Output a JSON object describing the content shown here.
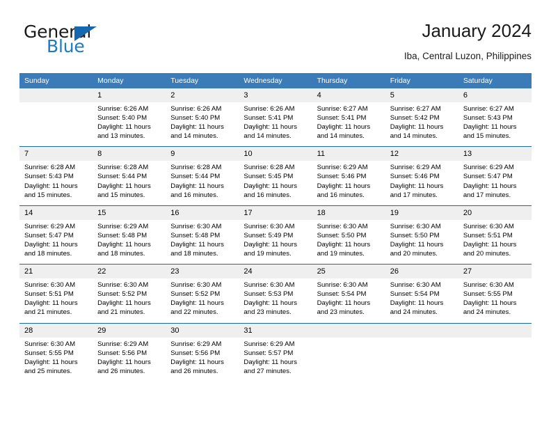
{
  "brand": {
    "name_part1": "General",
    "name_part2": "Blue",
    "accent_color": "#1d7bc1",
    "triangle_color": "#1667b0"
  },
  "header": {
    "title": "January 2024",
    "subtitle": "Iba, Central Luzon, Philippines"
  },
  "calendar": {
    "header_bg": "#3b7cb8",
    "daynum_bg": "#efefef",
    "weekday_headers": [
      "Sunday",
      "Monday",
      "Tuesday",
      "Wednesday",
      "Thursday",
      "Friday",
      "Saturday"
    ],
    "weeks": [
      [
        {
          "day": "",
          "sunrise": "",
          "sunset": "",
          "daylight_line1": "",
          "daylight_line2": ""
        },
        {
          "day": "1",
          "sunrise": "Sunrise: 6:26 AM",
          "sunset": "Sunset: 5:40 PM",
          "daylight_line1": "Daylight: 11 hours",
          "daylight_line2": "and 13 minutes."
        },
        {
          "day": "2",
          "sunrise": "Sunrise: 6:26 AM",
          "sunset": "Sunset: 5:40 PM",
          "daylight_line1": "Daylight: 11 hours",
          "daylight_line2": "and 14 minutes."
        },
        {
          "day": "3",
          "sunrise": "Sunrise: 6:26 AM",
          "sunset": "Sunset: 5:41 PM",
          "daylight_line1": "Daylight: 11 hours",
          "daylight_line2": "and 14 minutes."
        },
        {
          "day": "4",
          "sunrise": "Sunrise: 6:27 AM",
          "sunset": "Sunset: 5:41 PM",
          "daylight_line1": "Daylight: 11 hours",
          "daylight_line2": "and 14 minutes."
        },
        {
          "day": "5",
          "sunrise": "Sunrise: 6:27 AM",
          "sunset": "Sunset: 5:42 PM",
          "daylight_line1": "Daylight: 11 hours",
          "daylight_line2": "and 14 minutes."
        },
        {
          "day": "6",
          "sunrise": "Sunrise: 6:27 AM",
          "sunset": "Sunset: 5:43 PM",
          "daylight_line1": "Daylight: 11 hours",
          "daylight_line2": "and 15 minutes."
        }
      ],
      [
        {
          "day": "7",
          "sunrise": "Sunrise: 6:28 AM",
          "sunset": "Sunset: 5:43 PM",
          "daylight_line1": "Daylight: 11 hours",
          "daylight_line2": "and 15 minutes."
        },
        {
          "day": "8",
          "sunrise": "Sunrise: 6:28 AM",
          "sunset": "Sunset: 5:44 PM",
          "daylight_line1": "Daylight: 11 hours",
          "daylight_line2": "and 15 minutes."
        },
        {
          "day": "9",
          "sunrise": "Sunrise: 6:28 AM",
          "sunset": "Sunset: 5:44 PM",
          "daylight_line1": "Daylight: 11 hours",
          "daylight_line2": "and 16 minutes."
        },
        {
          "day": "10",
          "sunrise": "Sunrise: 6:28 AM",
          "sunset": "Sunset: 5:45 PM",
          "daylight_line1": "Daylight: 11 hours",
          "daylight_line2": "and 16 minutes."
        },
        {
          "day": "11",
          "sunrise": "Sunrise: 6:29 AM",
          "sunset": "Sunset: 5:46 PM",
          "daylight_line1": "Daylight: 11 hours",
          "daylight_line2": "and 16 minutes."
        },
        {
          "day": "12",
          "sunrise": "Sunrise: 6:29 AM",
          "sunset": "Sunset: 5:46 PM",
          "daylight_line1": "Daylight: 11 hours",
          "daylight_line2": "and 17 minutes."
        },
        {
          "day": "13",
          "sunrise": "Sunrise: 6:29 AM",
          "sunset": "Sunset: 5:47 PM",
          "daylight_line1": "Daylight: 11 hours",
          "daylight_line2": "and 17 minutes."
        }
      ],
      [
        {
          "day": "14",
          "sunrise": "Sunrise: 6:29 AM",
          "sunset": "Sunset: 5:47 PM",
          "daylight_line1": "Daylight: 11 hours",
          "daylight_line2": "and 18 minutes."
        },
        {
          "day": "15",
          "sunrise": "Sunrise: 6:29 AM",
          "sunset": "Sunset: 5:48 PM",
          "daylight_line1": "Daylight: 11 hours",
          "daylight_line2": "and 18 minutes."
        },
        {
          "day": "16",
          "sunrise": "Sunrise: 6:30 AM",
          "sunset": "Sunset: 5:48 PM",
          "daylight_line1": "Daylight: 11 hours",
          "daylight_line2": "and 18 minutes."
        },
        {
          "day": "17",
          "sunrise": "Sunrise: 6:30 AM",
          "sunset": "Sunset: 5:49 PM",
          "daylight_line1": "Daylight: 11 hours",
          "daylight_line2": "and 19 minutes."
        },
        {
          "day": "18",
          "sunrise": "Sunrise: 6:30 AM",
          "sunset": "Sunset: 5:50 PM",
          "daylight_line1": "Daylight: 11 hours",
          "daylight_line2": "and 19 minutes."
        },
        {
          "day": "19",
          "sunrise": "Sunrise: 6:30 AM",
          "sunset": "Sunset: 5:50 PM",
          "daylight_line1": "Daylight: 11 hours",
          "daylight_line2": "and 20 minutes."
        },
        {
          "day": "20",
          "sunrise": "Sunrise: 6:30 AM",
          "sunset": "Sunset: 5:51 PM",
          "daylight_line1": "Daylight: 11 hours",
          "daylight_line2": "and 20 minutes."
        }
      ],
      [
        {
          "day": "21",
          "sunrise": "Sunrise: 6:30 AM",
          "sunset": "Sunset: 5:51 PM",
          "daylight_line1": "Daylight: 11 hours",
          "daylight_line2": "and 21 minutes."
        },
        {
          "day": "22",
          "sunrise": "Sunrise: 6:30 AM",
          "sunset": "Sunset: 5:52 PM",
          "daylight_line1": "Daylight: 11 hours",
          "daylight_line2": "and 21 minutes."
        },
        {
          "day": "23",
          "sunrise": "Sunrise: 6:30 AM",
          "sunset": "Sunset: 5:52 PM",
          "daylight_line1": "Daylight: 11 hours",
          "daylight_line2": "and 22 minutes."
        },
        {
          "day": "24",
          "sunrise": "Sunrise: 6:30 AM",
          "sunset": "Sunset: 5:53 PM",
          "daylight_line1": "Daylight: 11 hours",
          "daylight_line2": "and 23 minutes."
        },
        {
          "day": "25",
          "sunrise": "Sunrise: 6:30 AM",
          "sunset": "Sunset: 5:54 PM",
          "daylight_line1": "Daylight: 11 hours",
          "daylight_line2": "and 23 minutes."
        },
        {
          "day": "26",
          "sunrise": "Sunrise: 6:30 AM",
          "sunset": "Sunset: 5:54 PM",
          "daylight_line1": "Daylight: 11 hours",
          "daylight_line2": "and 24 minutes."
        },
        {
          "day": "27",
          "sunrise": "Sunrise: 6:30 AM",
          "sunset": "Sunset: 5:55 PM",
          "daylight_line1": "Daylight: 11 hours",
          "daylight_line2": "and 24 minutes."
        }
      ],
      [
        {
          "day": "28",
          "sunrise": "Sunrise: 6:30 AM",
          "sunset": "Sunset: 5:55 PM",
          "daylight_line1": "Daylight: 11 hours",
          "daylight_line2": "and 25 minutes."
        },
        {
          "day": "29",
          "sunrise": "Sunrise: 6:29 AM",
          "sunset": "Sunset: 5:56 PM",
          "daylight_line1": "Daylight: 11 hours",
          "daylight_line2": "and 26 minutes."
        },
        {
          "day": "30",
          "sunrise": "Sunrise: 6:29 AM",
          "sunset": "Sunset: 5:56 PM",
          "daylight_line1": "Daylight: 11 hours",
          "daylight_line2": "and 26 minutes."
        },
        {
          "day": "31",
          "sunrise": "Sunrise: 6:29 AM",
          "sunset": "Sunset: 5:57 PM",
          "daylight_line1": "Daylight: 11 hours",
          "daylight_line2": "and 27 minutes."
        },
        {
          "day": "",
          "sunrise": "",
          "sunset": "",
          "daylight_line1": "",
          "daylight_line2": ""
        },
        {
          "day": "",
          "sunrise": "",
          "sunset": "",
          "daylight_line1": "",
          "daylight_line2": ""
        },
        {
          "day": "",
          "sunrise": "",
          "sunset": "",
          "daylight_line1": "",
          "daylight_line2": ""
        }
      ]
    ]
  }
}
